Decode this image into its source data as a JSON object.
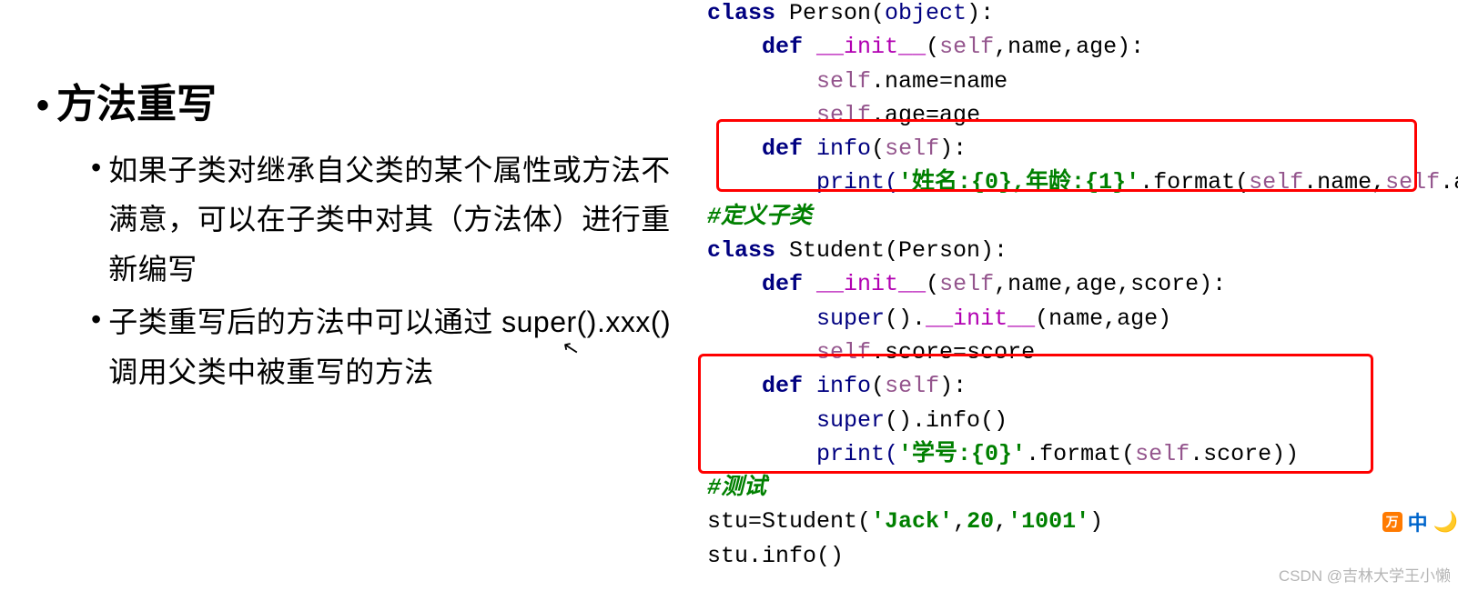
{
  "left": {
    "heading": "方法重写",
    "bullets": [
      "如果子类对继承自父类的某个属性或方法不满意，可以在子类中对其（方法体）进行重新编写",
      "子类重写后的方法中可以通过 super().xxx() 调用父类中被重写的方法"
    ]
  },
  "code": {
    "l01_class": "class",
    "l01_name": " Person(",
    "l01_obj": "object",
    "l01_end": "):",
    "l02_def": "def",
    "l02_mag": "__init__",
    "l02_self": "self",
    "l02_rest": ",name,age):",
    "l03_self": "self",
    "l03_rest": ".name=name",
    "l04_self": "self",
    "l04_rest": ".age=age",
    "l05_def": "def",
    "l05_fn": "info",
    "l05_self": "self",
    "l05_end": "):",
    "l06_print": "print(",
    "l06_str": "'姓名:{0},年龄:{1}'",
    "l06_mid": ".format(",
    "l06_s1": "self",
    "l06_m1": ".name,",
    "l06_s2": "self",
    "l06_m2": ".age))",
    "cmt1": "#定义子类",
    "l08_class": "class",
    "l08_rest": " Student(Person):",
    "l09_def": "def",
    "l09_mag": "__init__",
    "l09_self": "self",
    "l09_rest": ",name,age,score):",
    "l10_super": "super",
    "l10_mid": "().",
    "l10_mag": "__init__",
    "l10_rest": "(name,age)",
    "l11_self": "self",
    "l11_rest": ".score=score",
    "l12_def": "def",
    "l12_fn": "info",
    "l12_self": "self",
    "l12_end": "):",
    "l13_super": "super",
    "l13_rest": "().info()",
    "l14_print": "print(",
    "l14_str": "'学号:{0}'",
    "l14_mid": ".format(",
    "l14_self": "self",
    "l14_rest": ".score))",
    "cmt2": "#测试",
    "l16_a": "stu=Student(",
    "l16_s1": "'Jack'",
    "l16_c1": ",",
    "l16_n": "20",
    "l16_c2": ",",
    "l16_s2": "'1001'",
    "l16_e": ")",
    "l17": "stu.info()"
  },
  "watermark": "CSDN @吉林大学王小懒",
  "ime": {
    "zh": "中"
  }
}
